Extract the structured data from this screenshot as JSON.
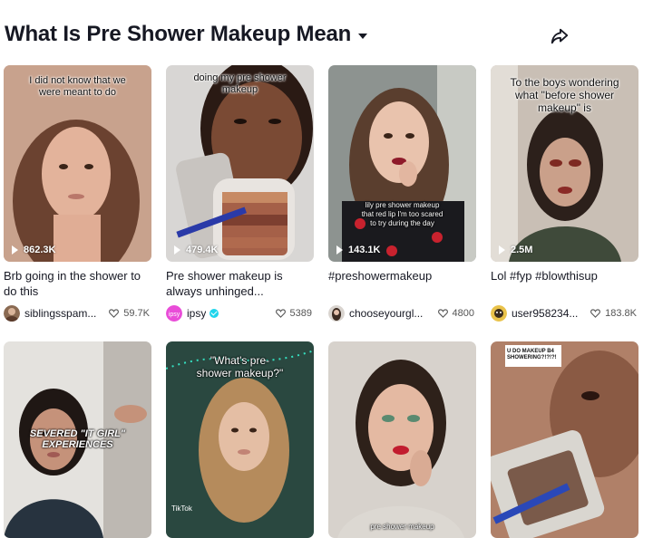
{
  "header": {
    "title": "What Is Pre Shower Makeup Mean",
    "dropdown_icon": "caret-down-icon",
    "share_icon": "share-icon"
  },
  "colors": {
    "text": "#161823",
    "muted": "#545454",
    "verified": "#20d5ec",
    "avatar_ipsy": "#e94cd8"
  },
  "videos": [
    {
      "overlay": "I did not know that we\nwere meant to do",
      "views": "862.3K",
      "desc": "Brb going in the shower to do this",
      "user": "siblingsspam...",
      "likes": "59.7K",
      "verified": false
    },
    {
      "overlay": "doing my pre shower\nmakeup",
      "views": "479.4K",
      "desc": "Pre shower makeup is always unhinged...",
      "user": "ipsy",
      "likes": "5389",
      "verified": true
    },
    {
      "overlay": "lily pre shower makeup\nthat red lip I'm too scared\nto try during the day",
      "views": "143.1K",
      "desc": "#preshowermakeup",
      "user": "chooseyourgl...",
      "likes": "4800",
      "verified": false
    },
    {
      "overlay": "To the boys wondering\nwhat \"before shower\nmakeup\" is",
      "views": "2.5M",
      "desc": "Lol #fyp #blowthisup",
      "user": "user958234...",
      "likes": "183.8K",
      "verified": false
    },
    {
      "overlay": "SEVERED \"IT GIRL\"\nEXPERIENCES",
      "views": "",
      "desc": "",
      "user": "",
      "likes": "",
      "verified": false
    },
    {
      "overlay": "\"What's pre-\nshower makeup?\"",
      "tiktok": "TikTok",
      "views": "",
      "desc": "",
      "user": "",
      "likes": "",
      "verified": false
    },
    {
      "overlay": "pre shower makeup",
      "views": "",
      "desc": "",
      "user": "",
      "likes": "",
      "verified": false
    },
    {
      "overlay": "U DO MAKEUP B4\nSHOWERING?!?!?!",
      "views": "",
      "desc": "",
      "user": "",
      "likes": "",
      "verified": false
    }
  ]
}
